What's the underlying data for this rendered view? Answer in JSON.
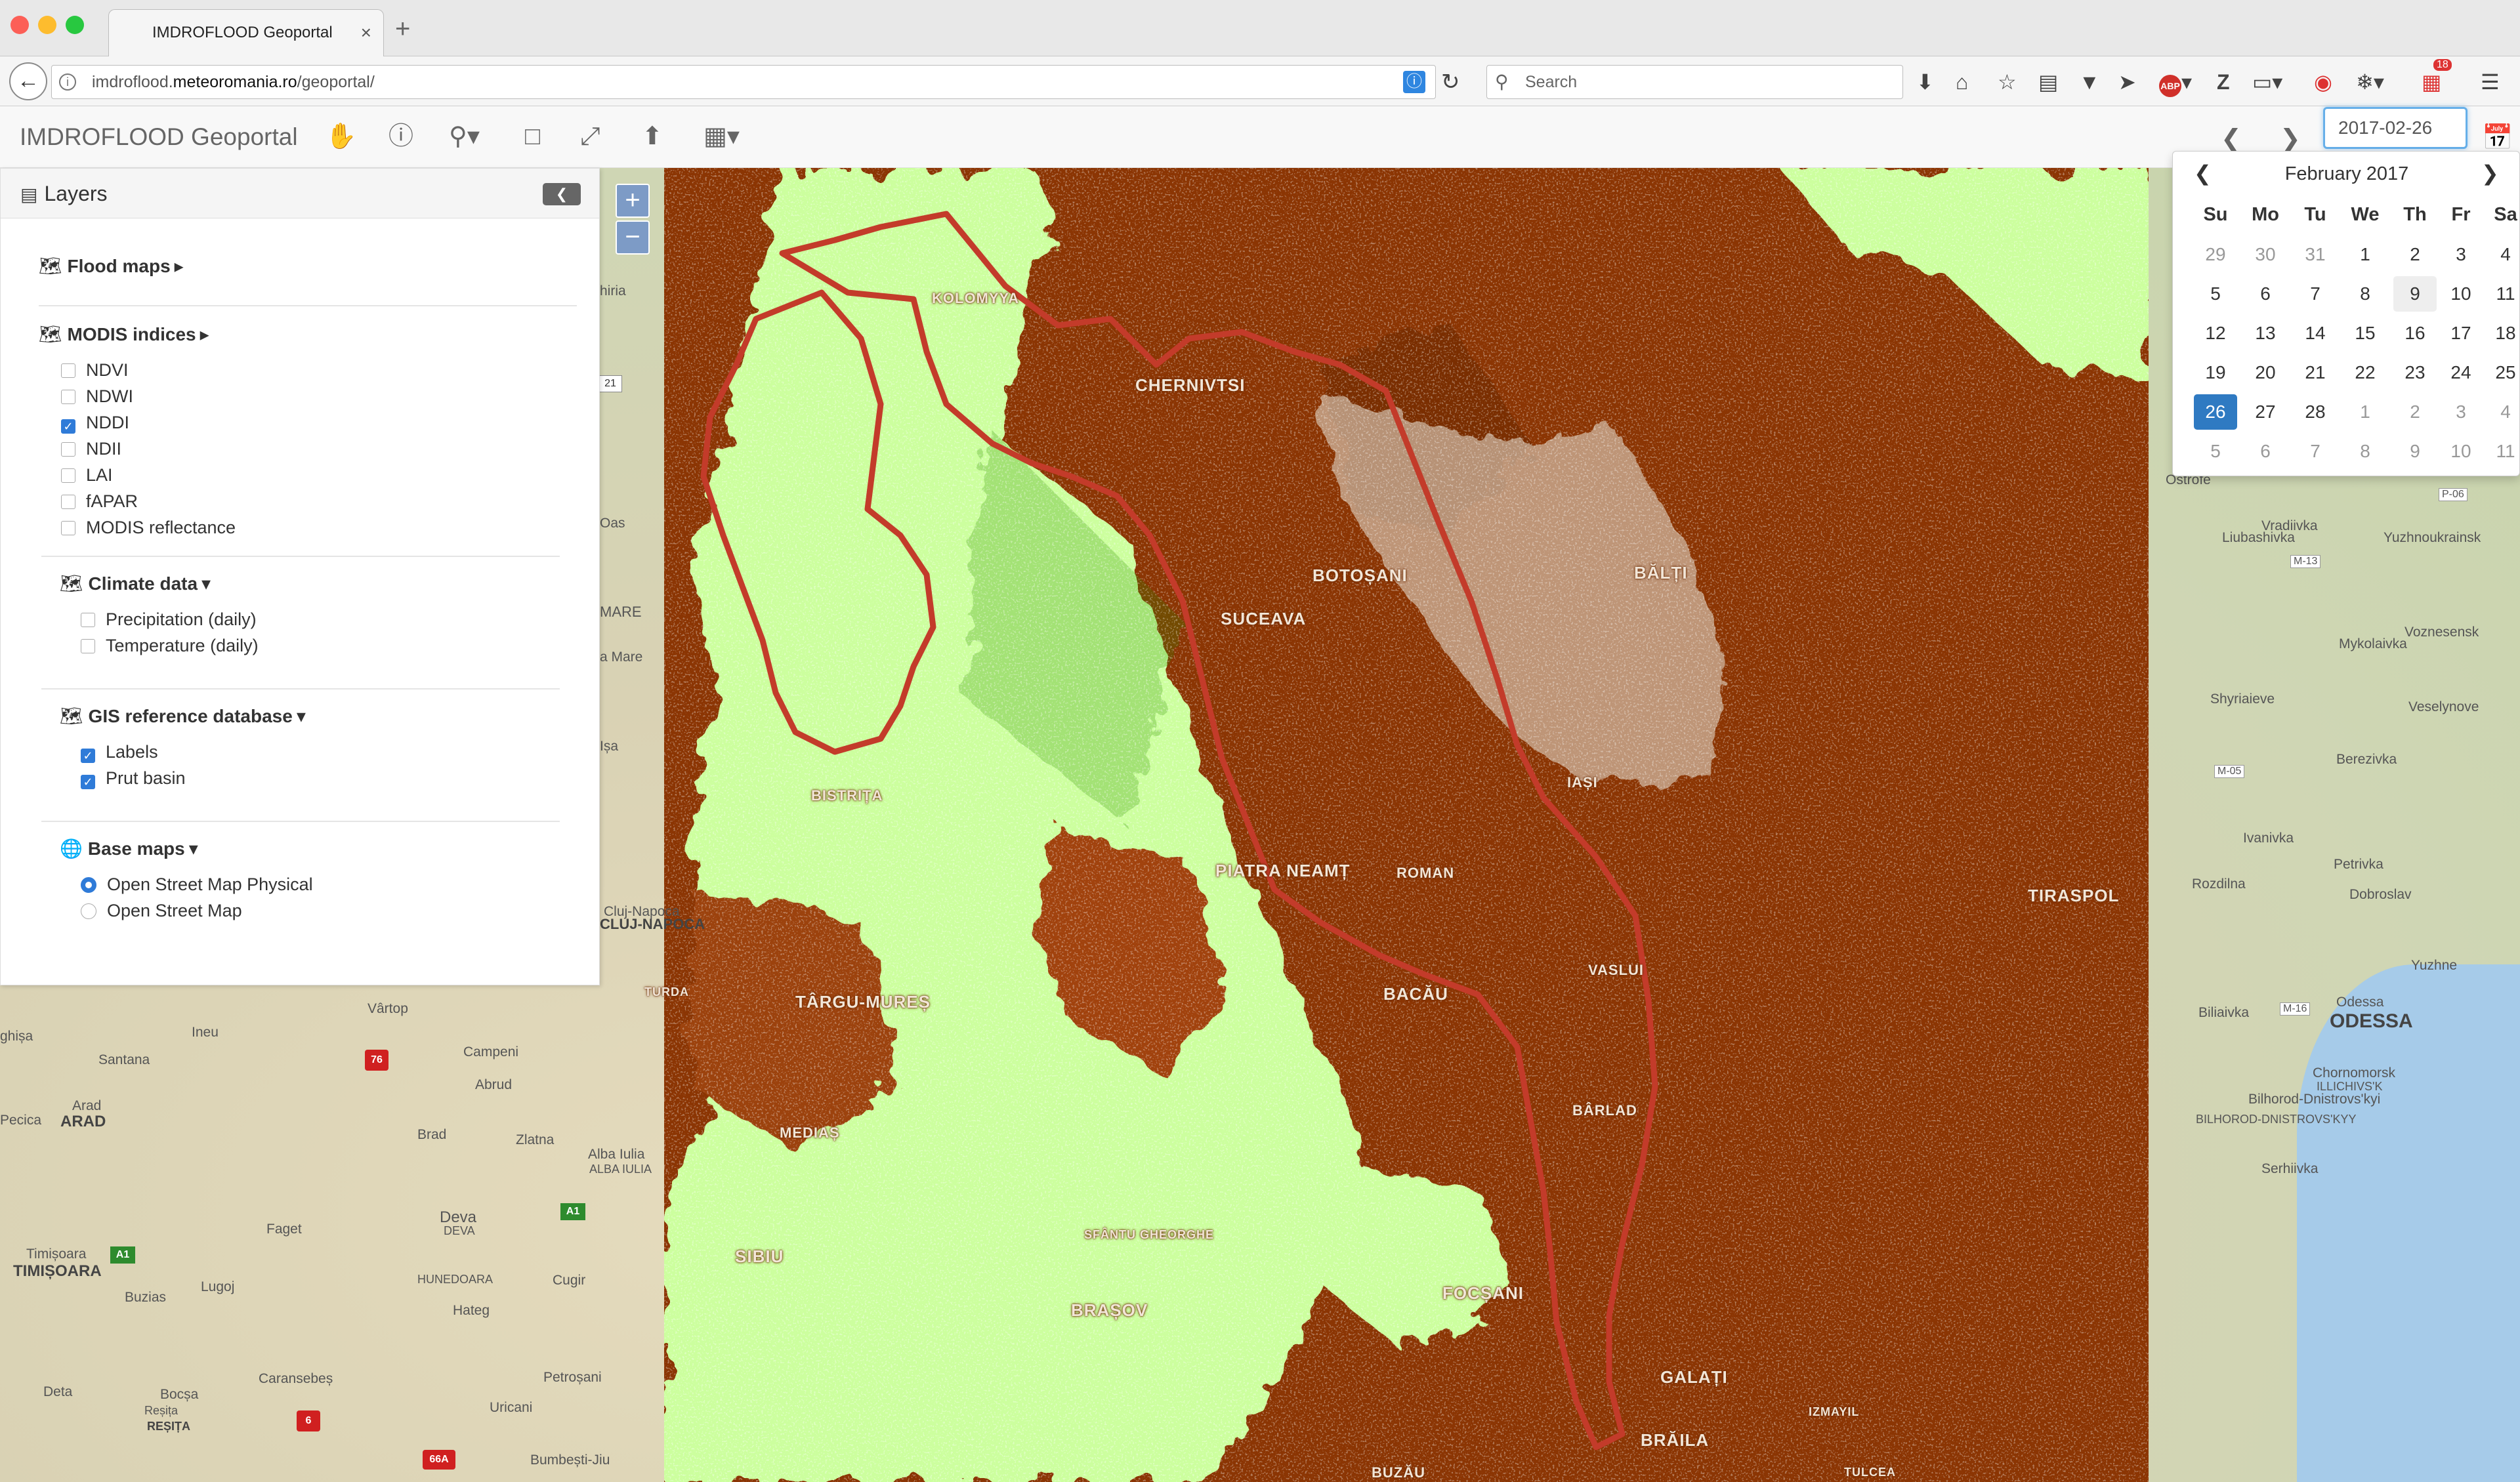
{
  "browser": {
    "tab_title": "IMDROFLOOD Geoportal",
    "tab_close": "×",
    "new_tab": "+",
    "url_prefix": "imdroflood.",
    "url_domain": "meteoromania.ro",
    "url_path": "/geoportal/",
    "search_placeholder": "Search",
    "badge_count": "18"
  },
  "app": {
    "title": "IMDROFLOOD Geoportal",
    "date_value": "2017-02-26"
  },
  "layers": {
    "title": "Layers",
    "groups": [
      {
        "label": "Flood maps",
        "caret": "▸"
      },
      {
        "label": "MODIS indices",
        "caret": "▸",
        "items": [
          {
            "label": "NDVI",
            "checked": false
          },
          {
            "label": "NDWI",
            "checked": false
          },
          {
            "label": "NDDI",
            "checked": true
          },
          {
            "label": "NDII",
            "checked": false
          },
          {
            "label": "LAI",
            "checked": false
          },
          {
            "label": "fAPAR",
            "checked": false
          },
          {
            "label": "MODIS reflectance",
            "checked": false
          }
        ]
      },
      {
        "label": "Climate data",
        "caret": "▾",
        "items": [
          {
            "label": "Precipitation (daily)",
            "checked": false
          },
          {
            "label": "Temperature (daily)",
            "checked": false
          }
        ]
      },
      {
        "label": "GIS reference database",
        "caret": "▾",
        "items": [
          {
            "label": "Labels",
            "checked": true
          },
          {
            "label": "Prut basin",
            "checked": true
          }
        ]
      },
      {
        "label": "Base maps",
        "caret": "▾",
        "items": [
          {
            "label": "Open Street Map Physical",
            "selected": true
          },
          {
            "label": "Open Street Map",
            "selected": false
          }
        ]
      }
    ]
  },
  "datepicker": {
    "month_label": "February 2017",
    "weekdays": [
      "Su",
      "Mo",
      "Tu",
      "We",
      "Th",
      "Fr",
      "Sa"
    ],
    "weeks": [
      [
        "29",
        "30",
        "31",
        "1",
        "2",
        "3",
        "4"
      ],
      [
        "5",
        "6",
        "7",
        "8",
        "9",
        "10",
        "11"
      ],
      [
        "12",
        "13",
        "14",
        "15",
        "16",
        "17",
        "18"
      ],
      [
        "19",
        "20",
        "21",
        "22",
        "23",
        "24",
        "25"
      ],
      [
        "26",
        "27",
        "28",
        "1",
        "2",
        "3",
        "4"
      ],
      [
        "5",
        "6",
        "7",
        "8",
        "9",
        "10",
        "11"
      ]
    ],
    "selected_day": "26",
    "hovered_day": "9"
  },
  "map_labels": {
    "overlay": [
      "KOLOMYYA",
      "CHERNIVTSI",
      "BOTOȘANI",
      "SUCEAVA",
      "BĂLȚI",
      "IAȘI",
      "BISTRIȚA",
      "PIATRA NEAMȚ",
      "ROMAN",
      "TIRASPOL",
      "VASLUI",
      "BACĂU",
      "TÂRGU-MUREȘ",
      "TURDA",
      "BÂRLAD",
      "MEDIAȘ",
      "SIBIU",
      "SFÂNTU GHEORGHE",
      "FOCȘANI",
      "BRAȘOV",
      "GALAȚI",
      "BRĂILA",
      "IZMAYIL",
      "BUZĂU",
      "TULCEA"
    ],
    "base": [
      "Ostrofe",
      "Liubashivka",
      "Vradiivka",
      "Yuzhnoukrainsk",
      "Voznesensk",
      "Mykolaivka",
      "Shyriaieve",
      "Veselynove",
      "Berezivka",
      "Ivanivka",
      "Petrivka",
      "Rozdilna",
      "Dobroslav",
      "Yuzhne",
      "Biliaivka",
      "ODESSA",
      "Odessa",
      "Chornomorsk",
      "ILLICHIVS'K",
      "Bilhorod-Dnistrovs'kyi",
      "BILHOROD-DNISTROVS'KYY",
      "Serhiivka",
      "Vârtop",
      "Ineu",
      "Santana",
      "Campeni",
      "Abrud",
      "ARAD",
      "Arad",
      "Pecica",
      "Brad",
      "Zlatna",
      "Alba Iulia",
      "ALBA IULIA",
      "Deva",
      "DEVA",
      "Timișoara",
      "TIMIȘOARA",
      "Faget",
      "Cugir",
      "Lugoj",
      "Buzias",
      "HUNEDOARA",
      "Hateg",
      "Caransebeș",
      "Petroșani",
      "Deta",
      "Bocșa",
      "Uricani",
      "REȘIȚA",
      "Reșița",
      "Bumbești-Jiu",
      "Cluj-Napoca",
      "CLUJ-NAPOCA",
      "ghișa",
      "Oas",
      "MARE",
      "a Mare",
      "hiria",
      "Ișa",
      "P-06",
      "M-13",
      "M-05",
      "M-16"
    ],
    "road_badges": [
      "76",
      "6",
      "66A",
      "A1",
      "A1",
      "21"
    ]
  }
}
